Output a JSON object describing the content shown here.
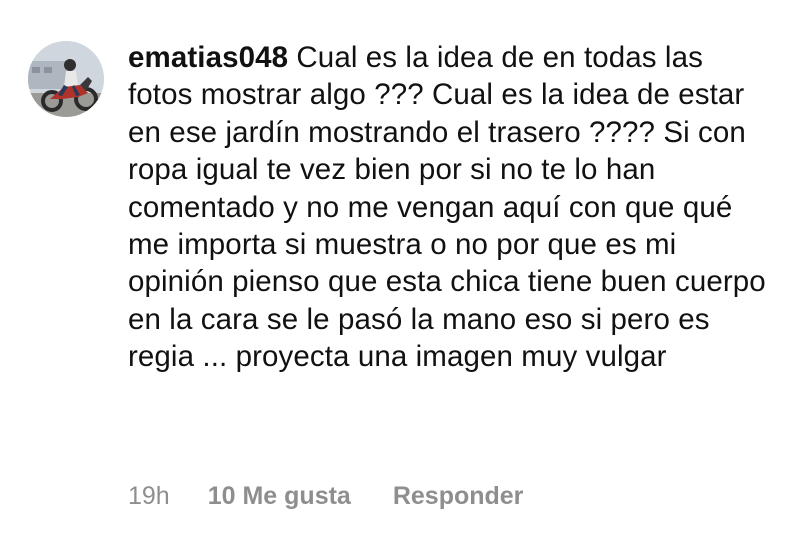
{
  "comment": {
    "username": "ematias048",
    "text": "Cual es la idea de en todas las fotos mostrar algo ??? Cual es la idea de estar en ese jardín mostrando el trasero ???? Si con ropa igual te vez bien por si no te lo han comentado y no me vengan aquí con que qué me importa si muestra o no por que es mi opinión pienso que esta chica tiene buen cuerpo en la cara se le pasó la mano eso si pero es regia ... proyecta una imagen muy vulgar",
    "time": "19h",
    "likes": "10 Me gusta",
    "reply_label": "Responder",
    "avatar_icon": "profile-photo-motorcycle-icon"
  },
  "colors": {
    "text": "#111111",
    "meta": "#8e8e8e",
    "background": "#ffffff"
  }
}
